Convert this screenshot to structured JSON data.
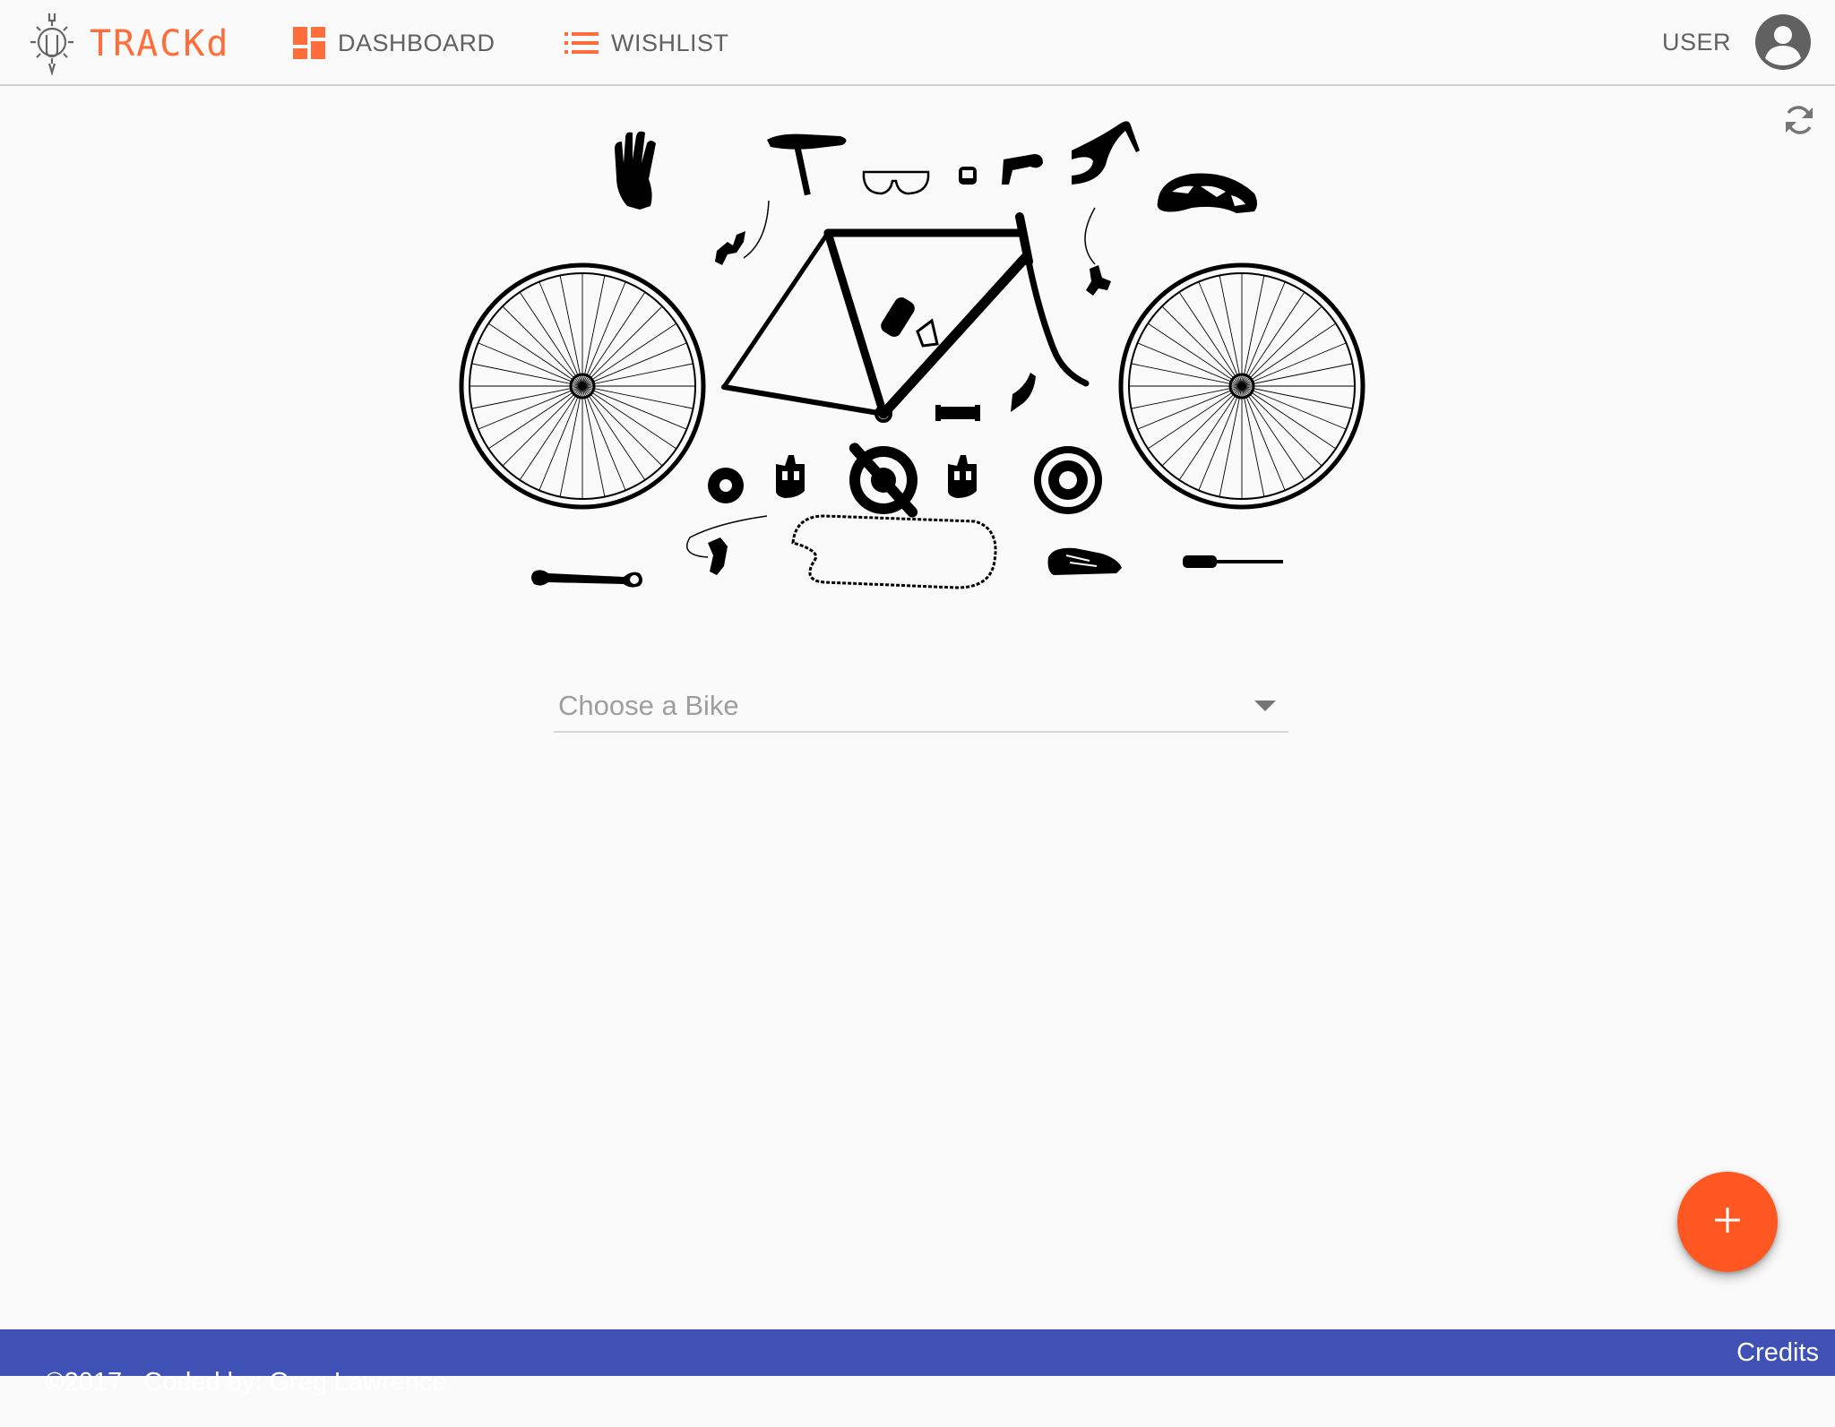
{
  "app": {
    "name": "TRACKd",
    "brand_color": "#ff6d3a",
    "logo_icon": "gear-wrench-icon"
  },
  "nav": {
    "items": [
      {
        "label": "DASHBOARD",
        "icon": "dashboard-icon",
        "icon_color": "#ff6d3a"
      },
      {
        "label": "WISHLIST",
        "icon": "list-icon",
        "icon_color": "#ff6d3a"
      }
    ]
  },
  "user": {
    "label": "USER",
    "icon": "account-circle-icon"
  },
  "toolbar": {
    "refresh_icon": "refresh-icon"
  },
  "hero": {
    "illustration": "bicycle-parts-illustration"
  },
  "bike_select": {
    "placeholder": "Choose a Bike"
  },
  "fab": {
    "icon": "plus-icon",
    "color": "#ff5722"
  },
  "footer": {
    "copyright": "©2017",
    "credit": "Coded by: Greg Lawrence",
    "credits_link": "Credits",
    "color": "#3f51b5"
  }
}
